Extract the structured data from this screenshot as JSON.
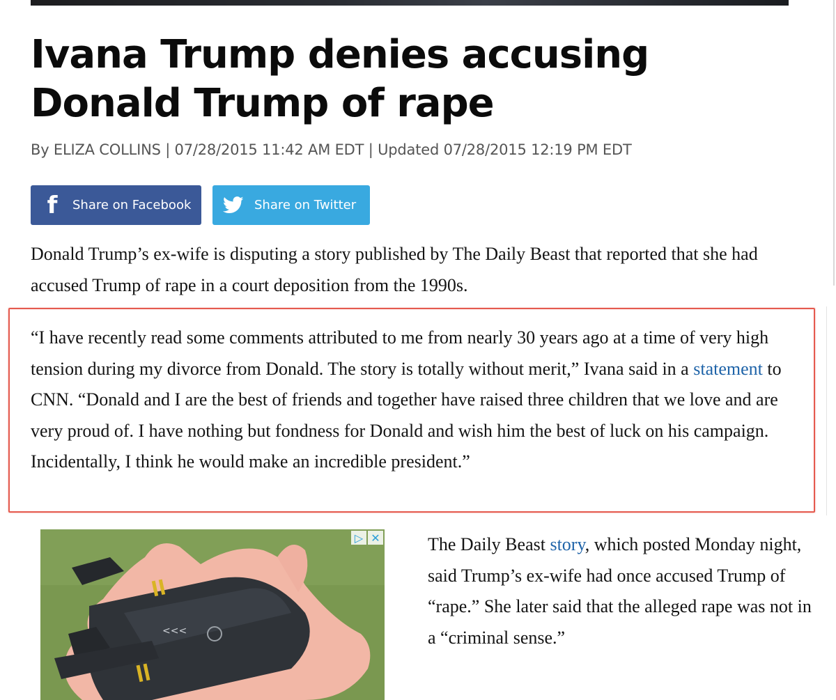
{
  "article": {
    "headline": "Ivana Trump denies accusing Donald Trump of rape",
    "byline": "By ELIZA COLLINS | 07/28/2015 11:42 AM EDT | Updated 07/28/2015 12:19 PM EDT",
    "share": {
      "facebook_label": "Share on Facebook",
      "twitter_label": "Share on Twitter",
      "facebook_icon": "facebook-icon",
      "twitter_icon": "twitter-bird-icon"
    },
    "paragraph1": "Donald Trump’s ex-wife is disputing a story published by The Daily Beast that reported that she had accused Trump of rape in a court deposition from the 1990s.",
    "paragraph2": {
      "before_link": "“I have recently read some comments attributed to me from nearly 30 years ago at a time of very high tension during my divorce from Donald. The story is totally without merit,” Ivana said in a ",
      "link_text": "statement",
      "after_link": " to CNN. “Donald and I are the best of friends and together have raised three children that we love and are very proud of. I have nothing but fondness for Donald and wish him the best of luck on his campaign. Incidentally, I think he would make an incredible president.”"
    },
    "paragraph3": {
      "before_link": "The Daily Beast ",
      "link_text": "story",
      "after_link": ", which posted Monday night, said Trump’s ex-wife had once accused Trump of “rape.” She later said that the alleged rape was not in a “criminal sense.”"
    }
  },
  "ad": {
    "adchoices_icon": "adchoices-icon",
    "close_icon": "close-icon",
    "adchoices_glyph": "▷",
    "close_glyph": "✕"
  },
  "colors": {
    "highlight_border": "#e55a4e",
    "link": "#1e63a8",
    "facebook": "#3b5998",
    "twitter": "#39a9e0"
  }
}
